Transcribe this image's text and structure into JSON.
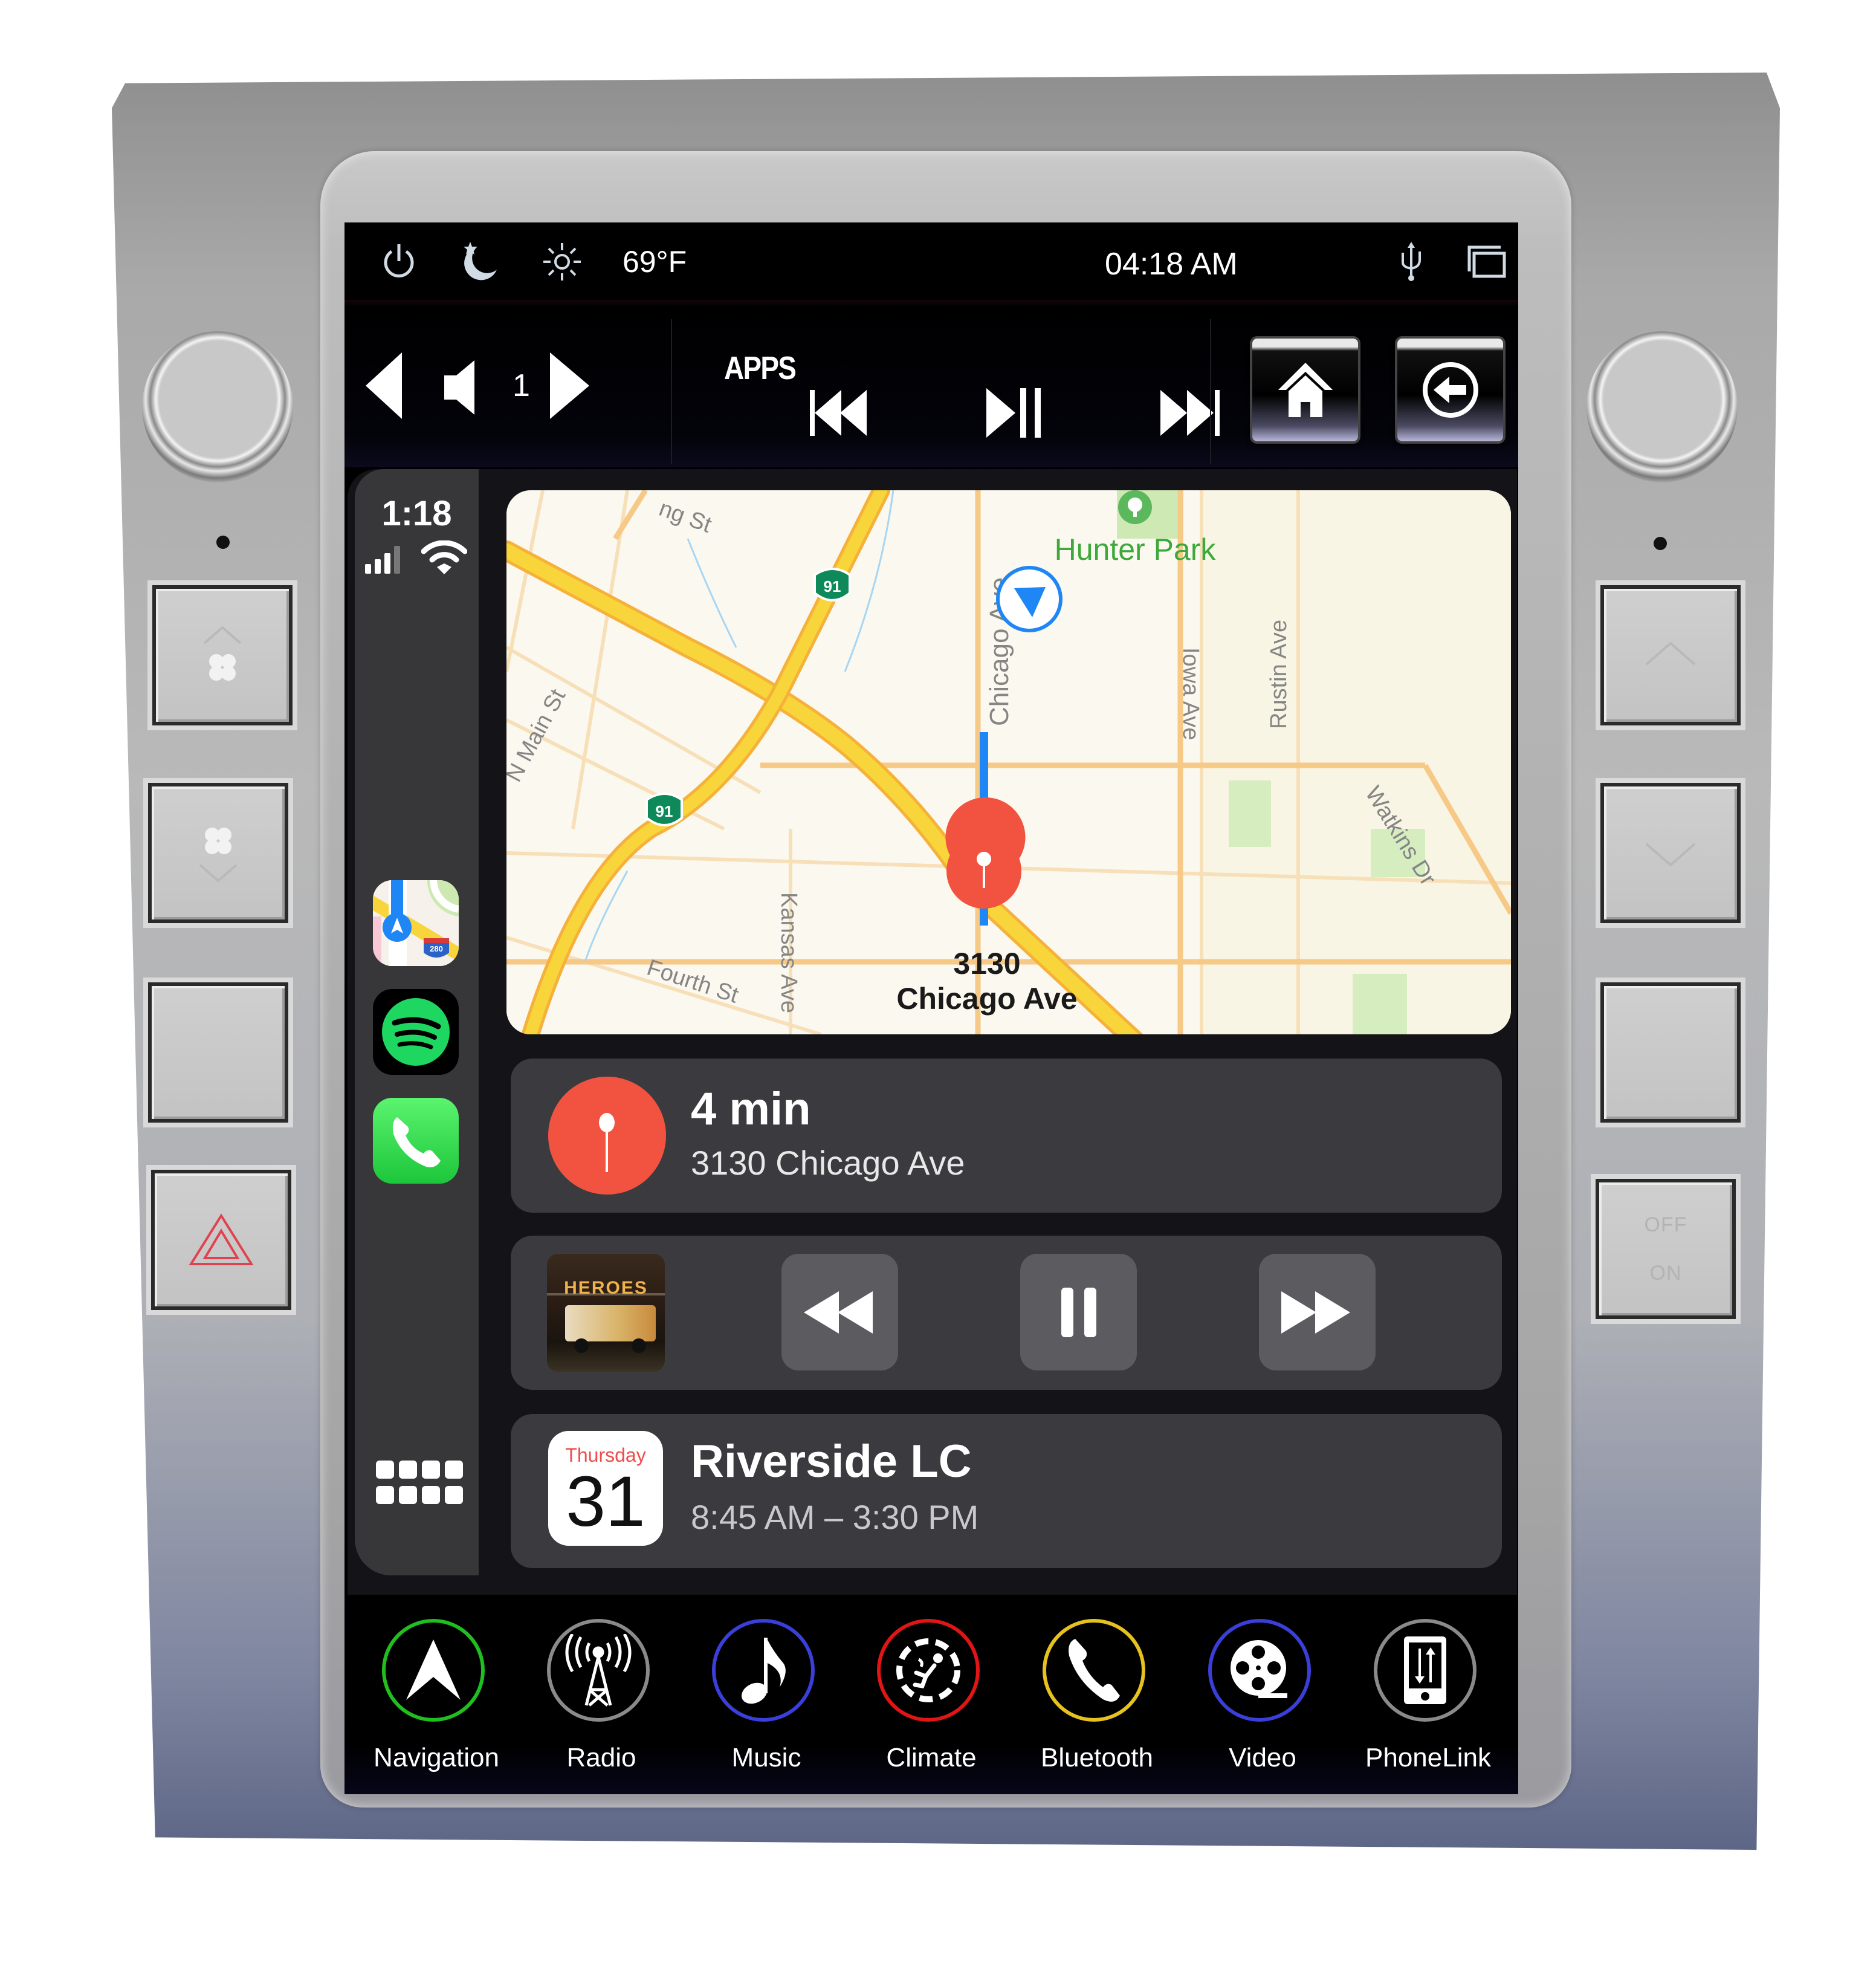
{
  "status_bar": {
    "icons": [
      "power-icon",
      "night-mode-icon",
      "brightness-icon"
    ],
    "temperature": "69°F",
    "time": "04:18 AM",
    "right_icons": [
      "usb-icon",
      "window-switch-icon"
    ]
  },
  "control_bar": {
    "volume_level": "1",
    "apps_label": "APPS",
    "buttons": [
      "volume-down",
      "volume",
      "volume-up",
      "previous-track",
      "play-pause",
      "next-track",
      "home",
      "back"
    ]
  },
  "carplay": {
    "time": "1:18",
    "signal_bars": 3,
    "signal_bars_total": 4,
    "sidebar_apps": [
      {
        "name": "Maps",
        "icon": "maps-app-icon",
        "badge": "280"
      },
      {
        "name": "Spotify",
        "icon": "spotify-app-icon"
      },
      {
        "name": "Phone",
        "icon": "phone-app-icon"
      }
    ],
    "app_grid_icon": "app-grid-icon",
    "map": {
      "labels": {
        "street_top": "ng St",
        "park": "Hunter Park",
        "chicago_ave": "Chicago Ave",
        "iowa_ave": "Iowa Ave",
        "rustin_ave": "Rustin Ave",
        "n_main_st": "N Main St",
        "watkins_dr": "Watkins Dr",
        "kansas_ave": "Kansas Ave",
        "fourth_st": "Fourth St",
        "highway_1": "91",
        "highway_2": "91",
        "destination_line1": "3130",
        "destination_line2": "Chicago Ave"
      }
    },
    "navigation_card": {
      "eta": "4 min",
      "address": "3130 Chicago Ave"
    },
    "media_card": {
      "album_title": "HEROES",
      "controls": [
        "rewind",
        "pause",
        "fast-forward"
      ]
    },
    "calendar_card": {
      "weekday": "Thursday",
      "day": "31",
      "event": "Riverside LC",
      "time_range": "8:45 AM – 3:30 PM"
    }
  },
  "dock": {
    "items": [
      {
        "label": "Navigation",
        "icon": "navigation-arrow-icon",
        "ring_color": "#1fbf1f"
      },
      {
        "label": "Radio",
        "icon": "radio-tower-icon",
        "ring_color": "#8a8a8a"
      },
      {
        "label": "Music",
        "icon": "music-note-icon",
        "ring_color": "#3a3fd9"
      },
      {
        "label": "Climate",
        "icon": "climate-seat-icon",
        "ring_color": "#e01515"
      },
      {
        "label": "Bluetooth",
        "icon": "phone-handset-icon",
        "ring_color": "#e6c21e"
      },
      {
        "label": "Video",
        "icon": "film-reel-icon",
        "ring_color": "#3a3fd9"
      },
      {
        "label": "PhoneLink",
        "icon": "phonelink-icon",
        "ring_color": "#8a8a8a"
      }
    ]
  },
  "hardware": {
    "right_bottom_button": {
      "top_label": "OFF",
      "bottom_label": "ON"
    },
    "left_buttons": [
      "fan-up",
      "fan-down",
      "blank",
      "hazard"
    ],
    "right_buttons": [
      "up",
      "down",
      "blank",
      "off-on"
    ]
  },
  "colors": {
    "accent_red": "#f25340",
    "route_blue": "#1f86f5",
    "park_green": "#3da83b",
    "highway_yellow": "#f8d53a",
    "card_bg": "#3b3b3f"
  }
}
